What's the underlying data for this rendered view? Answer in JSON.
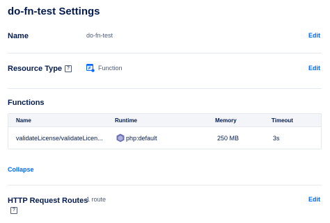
{
  "page": {
    "title": "do-fn-test Settings"
  },
  "name_row": {
    "label": "Name",
    "value": "do-fn-test",
    "edit": "Edit"
  },
  "resource_row": {
    "label": "Resource Type",
    "help": "?",
    "value": "Function",
    "edit": "Edit"
  },
  "functions": {
    "heading": "Functions",
    "columns": [
      "Name",
      "Runtime",
      "Memory",
      "Timeout"
    ],
    "rows": [
      {
        "name": "validateLicense/validateLicen...",
        "runtime": "php:default",
        "memory": "250 MB",
        "timeout": "3s"
      }
    ],
    "collapse": "Collapse"
  },
  "routes_row": {
    "label": "HTTP Request Routes",
    "help": "?",
    "value": "1 route",
    "edit": "Edit"
  },
  "colors": {
    "accent": "#0069ff",
    "text": "#031b4e",
    "muted": "#4d5b7c",
    "border": "#e5e8ed"
  },
  "icons": {
    "function": "function-icon",
    "php": "php-icon",
    "help": "help-icon"
  }
}
